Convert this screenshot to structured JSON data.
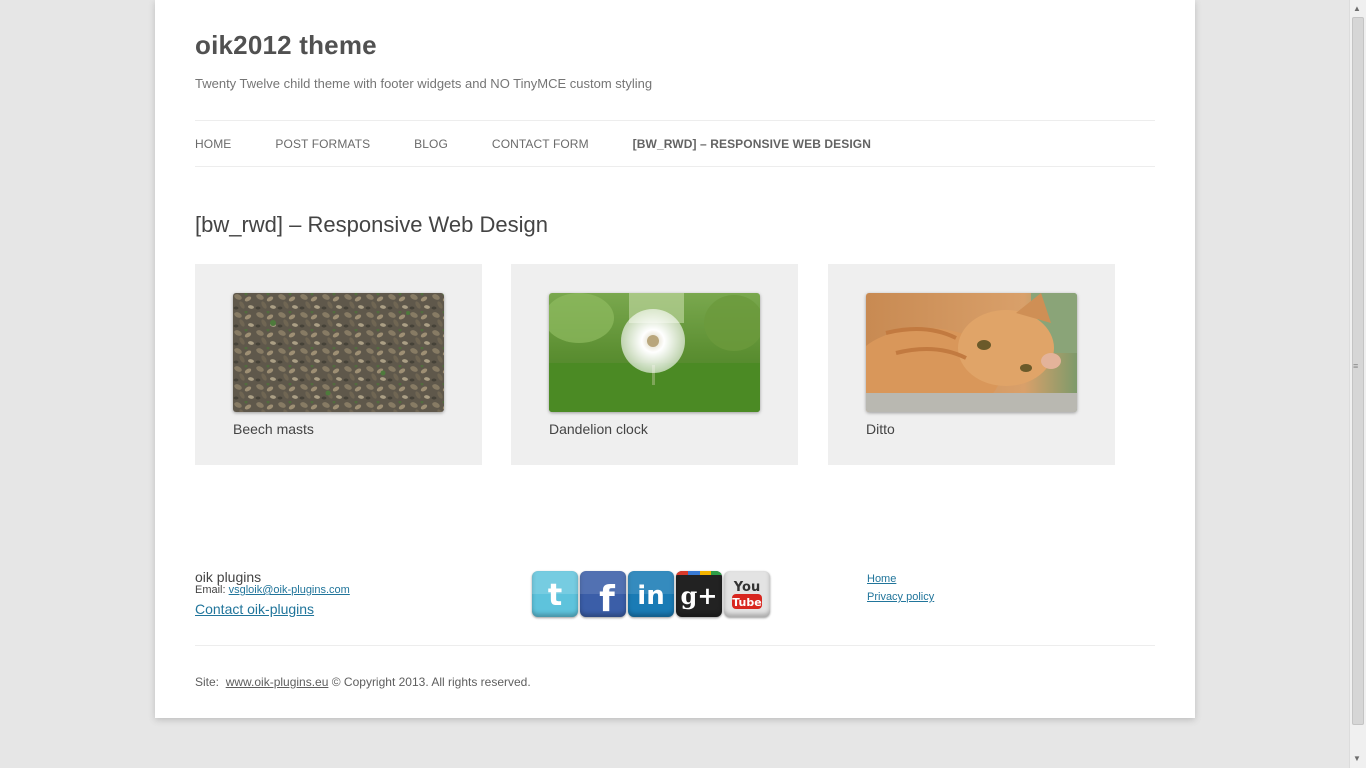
{
  "site": {
    "title": "oik2012 theme",
    "description": "Twenty Twelve child theme with footer widgets and NO TinyMCE custom styling"
  },
  "nav": {
    "items": [
      {
        "label": "Home"
      },
      {
        "label": "Post Formats"
      },
      {
        "label": "Blog"
      },
      {
        "label": "Contact Form"
      },
      {
        "label": "[bw_rwd] – Responsive Web Design"
      }
    ],
    "current_index": 4
  },
  "entry": {
    "title": "[bw_rwd] – Responsive Web Design"
  },
  "gallery": [
    {
      "caption": "Beech masts",
      "image": "leaf-litter"
    },
    {
      "caption": "Dandelion clock",
      "image": "dandelion"
    },
    {
      "caption": "Ditto",
      "image": "ginger-cat"
    }
  ],
  "footer": {
    "widget_title": "oik plugins",
    "email_label": "Email:",
    "email": "vsgloik@oik-plugins.com",
    "contact_link": "Contact oik-plugins",
    "social": [
      {
        "name": "twitter-icon",
        "color": "#5ec3dc"
      },
      {
        "name": "facebook-icon",
        "color": "#3b5ea8"
      },
      {
        "name": "linkedin-icon",
        "color": "#1a7bb5"
      },
      {
        "name": "google-plus-icon",
        "color": "#222222"
      },
      {
        "name": "youtube-icon",
        "color": "#e3e3e3"
      }
    ],
    "links": [
      {
        "label": "Home"
      },
      {
        "label": "Privacy policy"
      }
    ],
    "site_label": "Site:",
    "site_url": "www.oik-plugins.eu",
    "copyright": "© Copyright 2013. All rights reserved."
  },
  "colors": {
    "link": "#21759b",
    "background": "#e6e6e6",
    "card": "#efefef"
  }
}
